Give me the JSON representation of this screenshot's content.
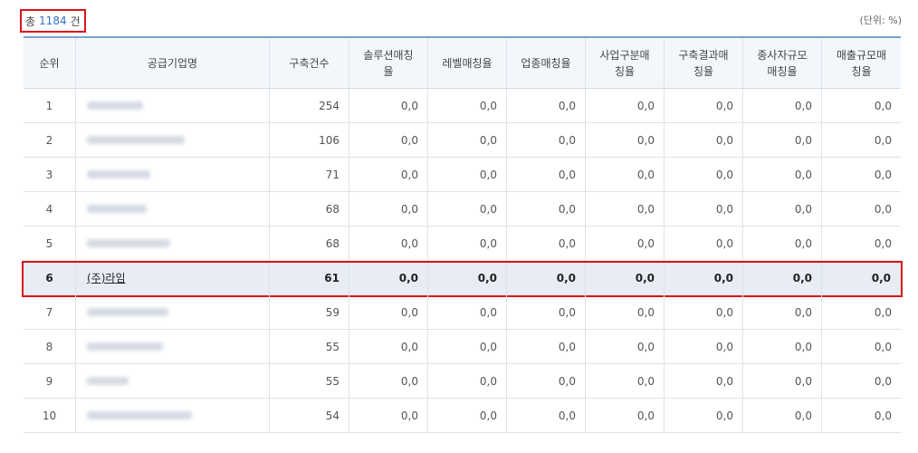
{
  "summary": {
    "prefix": "총",
    "count": "1184",
    "suffix": "건"
  },
  "unit_label": "(단위: %)",
  "columns": [
    "순위",
    "공급기업명",
    "구축건수",
    "솔루션매칭\n율",
    "레벨매칭율",
    "업종매칭율",
    "사업구분매\n칭율",
    "구축결과매\n칭율",
    "종사자규모\n매칭율",
    "매출규모매\n칭율"
  ],
  "rows": [
    {
      "rank": "1",
      "company": "",
      "count": "254",
      "rates": [
        "0,0",
        "0,0",
        "0,0",
        "0,0",
        "0,0",
        "0,0",
        "0,0"
      ]
    },
    {
      "rank": "2",
      "company": "",
      "count": "106",
      "rates": [
        "0,0",
        "0,0",
        "0,0",
        "0,0",
        "0,0",
        "0,0",
        "0,0"
      ]
    },
    {
      "rank": "3",
      "company": "",
      "count": "71",
      "rates": [
        "0,0",
        "0,0",
        "0,0",
        "0,0",
        "0,0",
        "0,0",
        "0,0"
      ]
    },
    {
      "rank": "4",
      "company": "",
      "count": "68",
      "rates": [
        "0,0",
        "0,0",
        "0,0",
        "0,0",
        "0,0",
        "0,0",
        "0,0"
      ]
    },
    {
      "rank": "5",
      "company": "",
      "count": "68",
      "rates": [
        "0,0",
        "0,0",
        "0,0",
        "0,0",
        "0,0",
        "0,0",
        "0,0"
      ]
    },
    {
      "rank": "6",
      "company": "(주)라임",
      "count": "61",
      "rates": [
        "0,0",
        "0,0",
        "0,0",
        "0,0",
        "0,0",
        "0,0",
        "0,0"
      ]
    },
    {
      "rank": "7",
      "company": "",
      "count": "59",
      "rates": [
        "0,0",
        "0,0",
        "0,0",
        "0,0",
        "0,0",
        "0,0",
        "0,0"
      ]
    },
    {
      "rank": "8",
      "company": "",
      "count": "55",
      "rates": [
        "0,0",
        "0,0",
        "0,0",
        "0,0",
        "0,0",
        "0,0",
        "0,0"
      ]
    },
    {
      "rank": "9",
      "company": "",
      "count": "55",
      "rates": [
        "0,0",
        "0,0",
        "0,0",
        "0,0",
        "0,0",
        "0,0",
        "0,0"
      ]
    },
    {
      "rank": "10",
      "company": "",
      "count": "54",
      "rates": [
        "0,0",
        "0,0",
        "0,0",
        "0,0",
        "0,0",
        "0,0",
        "0,0"
      ]
    }
  ],
  "highlight_row_index": 5,
  "colors": {
    "accent_red": "#d9151c",
    "count_blue": "#2f72c4",
    "header_border": "#7aa3cc"
  }
}
